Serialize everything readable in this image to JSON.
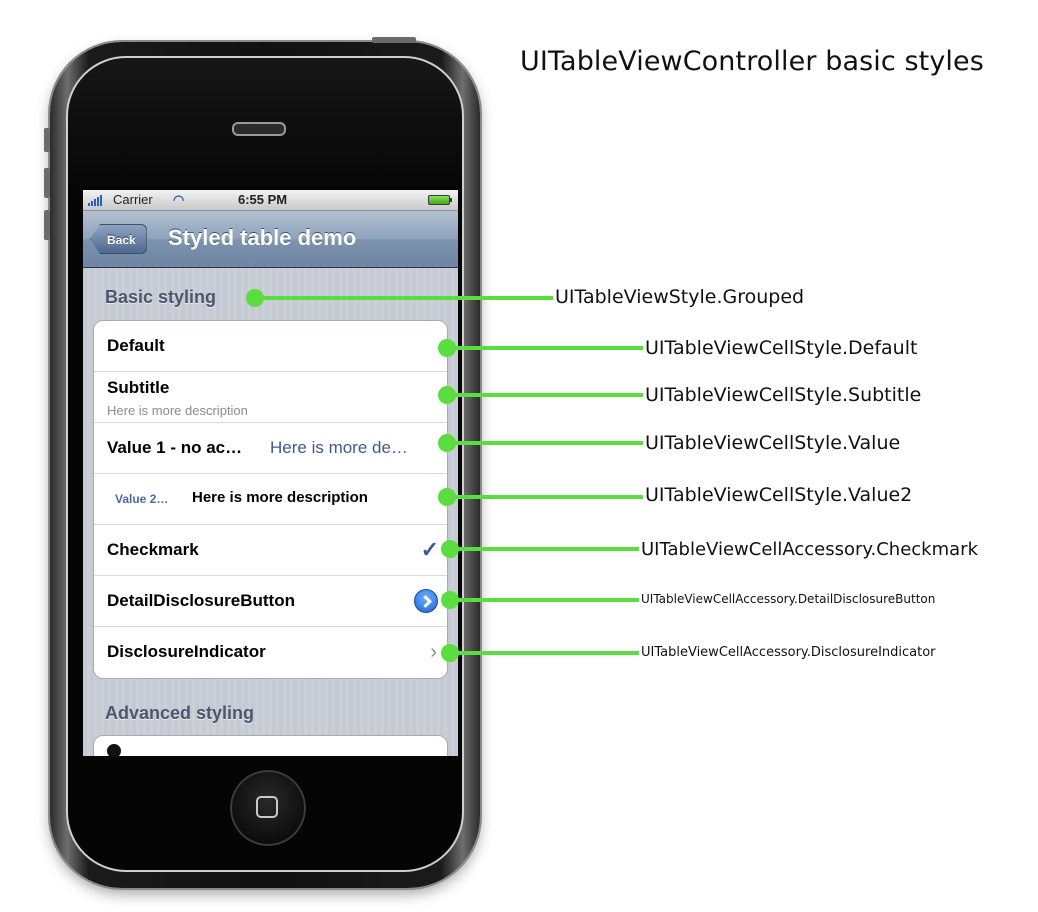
{
  "heading": "UITableViewController basic styles",
  "status_bar": {
    "carrier": "Carrier",
    "time": "6:55 PM"
  },
  "nav_bar": {
    "back_label": "Back",
    "title": "Styled table demo"
  },
  "sections": {
    "basic": {
      "header": "Basic styling"
    },
    "advanced": {
      "header": "Advanced styling"
    }
  },
  "cells": {
    "default": {
      "title": "Default"
    },
    "subtitle": {
      "title": "Subtitle",
      "subtitle": "Here is more description"
    },
    "value1": {
      "title": "Value 1 - no ac…",
      "detail": "Here is more de…"
    },
    "value2": {
      "label": "Value 2…",
      "detail": "Here is more description"
    },
    "checkmark": {
      "title": "Checkmark",
      "accessory_icon": "checkmark-icon"
    },
    "detail_disclosure": {
      "title": "DetailDisclosureButton",
      "accessory_icon": "detail-disclosure-icon"
    },
    "disclosure": {
      "title": "DisclosureIndicator",
      "accessory_icon": "chevron-right-icon"
    }
  },
  "callouts": [
    {
      "label": "UITableViewStyle.Grouped"
    },
    {
      "label": "UITableViewCellStyle.Default"
    },
    {
      "label": "UITableViewCellStyle.Subtitle"
    },
    {
      "label": "UITableViewCellStyle.Value"
    },
    {
      "label": "UITableViewCellStyle.Value2"
    },
    {
      "label": "UITableViewCellAccessory.Checkmark"
    },
    {
      "label": "UITableViewCellAccessory.DetailDisclosureButton"
    },
    {
      "label": "UITableViewCellAccessory.DisclosureIndicator"
    }
  ],
  "colors": {
    "callout": "#5bdc3f",
    "nav_bar": "#7d93ae",
    "detail_text": "#3f5a8e"
  }
}
